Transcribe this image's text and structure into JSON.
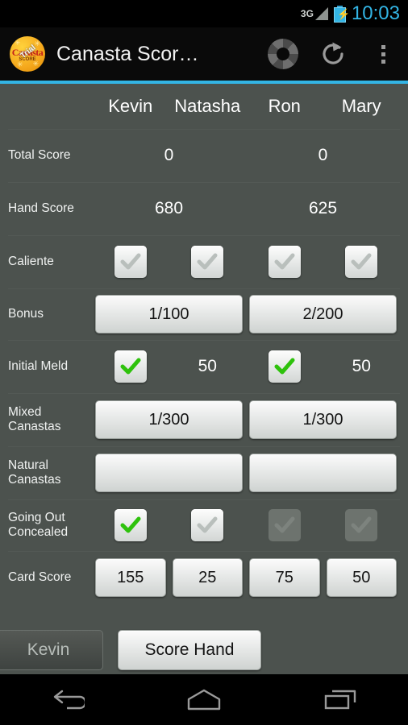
{
  "statusbar": {
    "network": "3G",
    "time": "10:03",
    "battery_icon": "battery-charging-icon",
    "signal_icon": "signal-bars-icon"
  },
  "actionbar": {
    "app_icon": "canasta-app-icon",
    "logo_text": "Canasta",
    "logo_sub": "SCORE",
    "logo_banner": "Trial",
    "title": "Canasta Scor…",
    "actions": [
      {
        "name": "help-ring-icon",
        "label": "Help"
      },
      {
        "name": "refresh-icon",
        "label": "Refresh"
      },
      {
        "name": "overflow-menu-icon",
        "label": "More options"
      }
    ]
  },
  "players": [
    "Kevin",
    "Natasha",
    "Ron",
    "Mary"
  ],
  "rows": {
    "total_score": {
      "label": "Total Score",
      "values": [
        "0",
        "0"
      ]
    },
    "hand_score": {
      "label": "Hand Score",
      "values": [
        "680",
        "625"
      ]
    },
    "caliente": {
      "label": "Caliente",
      "checks": [
        {
          "checked": false,
          "disabled": false
        },
        {
          "checked": false,
          "disabled": false
        },
        {
          "checked": false,
          "disabled": false
        },
        {
          "checked": false,
          "disabled": false
        }
      ]
    },
    "bonus": {
      "label": "Bonus",
      "values": [
        "1/100",
        "2/200"
      ]
    },
    "initial_meld": {
      "label": "Initial Meld",
      "checks": [
        {
          "checked": true,
          "disabled": false
        },
        {
          "checked": true,
          "disabled": false
        }
      ],
      "values": [
        "50",
        "50"
      ]
    },
    "mixed_canastas": {
      "label": "Mixed\nCanastas",
      "label_line1": "Mixed",
      "label_line2": "Canastas",
      "values": [
        "1/300",
        "1/300"
      ]
    },
    "natural_canastas": {
      "label_line1": "Natural",
      "label_line2": "Canastas",
      "values": [
        "",
        ""
      ]
    },
    "going_out_concealed": {
      "label_line1": "Going Out",
      "label_line2": "Concealed",
      "checks": [
        {
          "checked": true,
          "disabled": false
        },
        {
          "checked": false,
          "disabled": false
        },
        {
          "checked": false,
          "disabled": true
        },
        {
          "checked": false,
          "disabled": true
        }
      ]
    },
    "card_score": {
      "label": "Card Score",
      "values": [
        "155",
        "25",
        "75",
        "50"
      ]
    }
  },
  "bottom": {
    "player_selector": "Kevin",
    "score_hand_button": "Score Hand"
  },
  "navbar": {
    "back": "back-icon",
    "home": "home-icon",
    "recents": "recents-icon"
  },
  "colors": {
    "accent": "#33b5e5",
    "background": "#4c524e",
    "actionbar": "#0a0a0a",
    "check_green": "#2ec20c"
  }
}
